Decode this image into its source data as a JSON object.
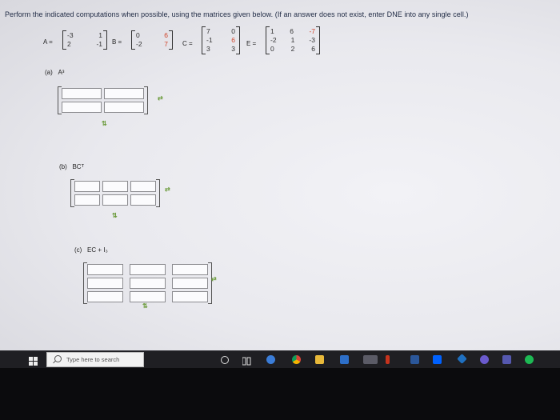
{
  "prompt": "Perform the indicated computations when possible, using the matrices given below. (If an answer does not exist, enter DNE into any single cell.)",
  "matrices": {
    "A": {
      "label": "A =",
      "rows": [
        [
          "-3",
          "1"
        ],
        [
          "2",
          "-1"
        ]
      ]
    },
    "B": {
      "label": "B =",
      "rows": [
        [
          "0",
          "6"
        ],
        [
          "-2",
          "7"
        ]
      ]
    },
    "C": {
      "label": "C =",
      "rows": [
        [
          "7",
          "0"
        ],
        [
          "-1",
          "6"
        ],
        [
          "3",
          "3"
        ]
      ]
    },
    "E": {
      "label": "E =",
      "rows": [
        [
          "1",
          "6",
          "-7"
        ],
        [
          "-2",
          "1",
          "-3"
        ],
        [
          "0",
          "2",
          "6"
        ]
      ]
    }
  },
  "parts": [
    {
      "letter": "(a)",
      "expr": "A³",
      "rows": 2,
      "cols": 2
    },
    {
      "letter": "(b)",
      "expr": "BCᵀ",
      "rows": 2,
      "cols": 3
    },
    {
      "letter": "(c)",
      "expr": "EC + I₃",
      "rows": 3,
      "cols": 3
    }
  ],
  "taskbar": {
    "search_placeholder": "Type here to search",
    "icons": [
      "windows-start-icon",
      "cortana-icon",
      "task-view-icon",
      "edge-icon",
      "chrome-icon",
      "file-explorer-icon",
      "mail-icon",
      "store-icon",
      "office-icon",
      "word-icon",
      "dropbox-icon",
      "settings-icon",
      "teams-icon",
      "spotify-icon"
    ]
  }
}
